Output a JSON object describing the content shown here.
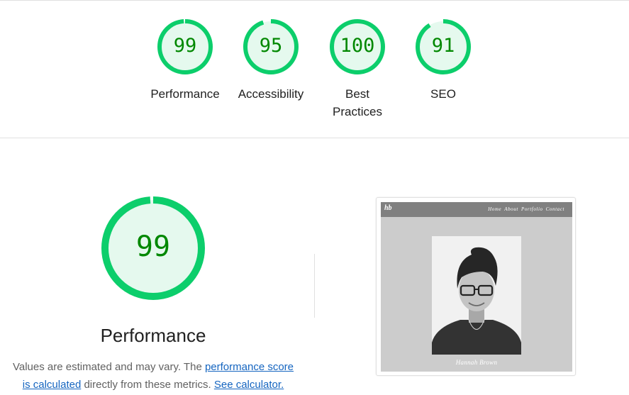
{
  "summary": {
    "categories": [
      {
        "label": "Performance",
        "score": "99",
        "score_fraction": 0.99
      },
      {
        "label": "Accessibility",
        "score": "95",
        "score_fraction": 0.95
      },
      {
        "label": "Best Practices",
        "score": "100",
        "score_fraction": 1.0
      },
      {
        "label": "SEO",
        "score": "91",
        "score_fraction": 0.91
      }
    ]
  },
  "performance": {
    "score": "99",
    "score_fraction": 0.99,
    "title": "Performance",
    "note_prefix": "Values are estimated and may vary. The ",
    "note_link1": "performance score is calculated",
    "note_middle": " directly from these metrics. ",
    "note_link2": "See calculator."
  },
  "screenshot": {
    "logo": "hb",
    "nav_links": [
      "Home",
      "About",
      "Portfolio",
      "Contact"
    ],
    "name": "Hannah Brown"
  },
  "colors": {
    "pass_green": "#0cce6b",
    "pass_fill": "#e5f9ee",
    "pass_text": "#008800",
    "link": "#1565c0"
  }
}
